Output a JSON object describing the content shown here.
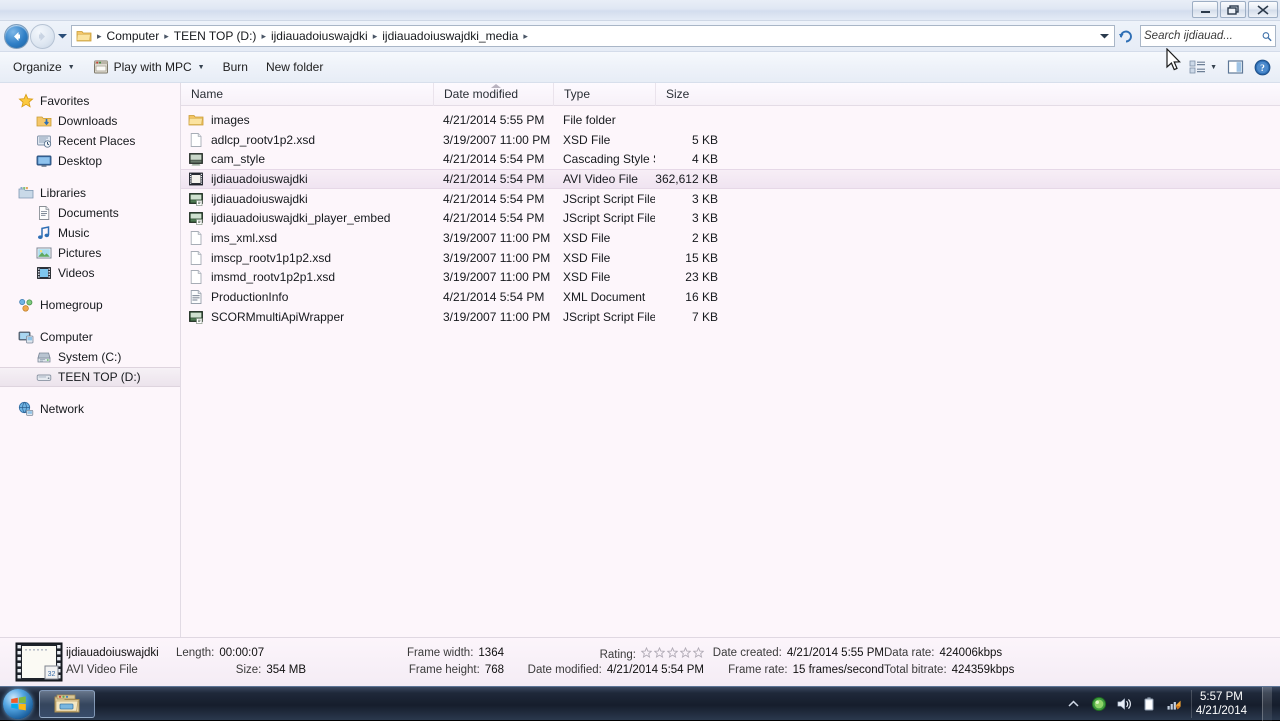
{
  "window": {
    "controls": [
      {
        "name": "minimize",
        "glyph": "minimize-icon"
      },
      {
        "name": "maximize",
        "glyph": "maximize-icon"
      },
      {
        "name": "close",
        "glyph": "close-icon"
      }
    ]
  },
  "address": {
    "back_label": "Back",
    "forward_label": "Forward",
    "recent_pages_label": "Recent pages",
    "breadcrumbs": [
      "Computer",
      "TEEN TOP (D:)",
      "ijdiauadoiuswajdki",
      "ijdiauadoiuswajdki_media"
    ],
    "dropdown_label": "Previous locations",
    "refresh_label": "Refresh",
    "separator": "▸"
  },
  "search": {
    "placeholder": "Search ijdiauad...",
    "value": "",
    "icon": "search-icon"
  },
  "toolbar": {
    "organize_label": "Organize",
    "play_label": "Play with MPC",
    "burn_label": "Burn",
    "new_folder_label": "New folder",
    "view_icon": "change-view-icon",
    "preview_icon": "preview-pane-icon",
    "help_icon": "help-icon"
  },
  "sidebar": {
    "groups": [
      {
        "header": {
          "label": "Favorites",
          "icon": "star-icon"
        },
        "items": [
          {
            "label": "Downloads",
            "icon": "downloads-icon"
          },
          {
            "label": "Recent Places",
            "icon": "recent-places-icon"
          },
          {
            "label": "Desktop",
            "icon": "desktop-icon"
          }
        ]
      },
      {
        "header": {
          "label": "Libraries",
          "icon": "libraries-icon"
        },
        "items": [
          {
            "label": "Documents",
            "icon": "documents-icon"
          },
          {
            "label": "Music",
            "icon": "music-icon"
          },
          {
            "label": "Pictures",
            "icon": "pictures-icon"
          },
          {
            "label": "Videos",
            "icon": "videos-icon"
          }
        ]
      },
      {
        "header": {
          "label": "Homegroup",
          "icon": "homegroup-icon"
        },
        "items": []
      },
      {
        "header": {
          "label": "Computer",
          "icon": "computer-icon"
        },
        "items": [
          {
            "label": "System (C:)",
            "icon": "hard-drive-icon",
            "selected": false
          },
          {
            "label": "TEEN TOP (D:)",
            "icon": "removable-drive-icon",
            "selected": true
          }
        ]
      },
      {
        "header": {
          "label": "Network",
          "icon": "network-icon"
        },
        "items": []
      }
    ]
  },
  "filelist": {
    "columns": [
      {
        "label": "Name",
        "key": "name"
      },
      {
        "label": "Date modified",
        "key": "date"
      },
      {
        "label": "Type",
        "key": "type"
      },
      {
        "label": "Size",
        "key": "size"
      }
    ],
    "sort": {
      "column": "Name",
      "direction": "ascending"
    },
    "rows": [
      {
        "name": "images",
        "date": "4/21/2014 5:55 PM",
        "type": "File folder",
        "size": "",
        "icon": "folder-icon",
        "selected": false
      },
      {
        "name": "adlcp_rootv1p2.xsd",
        "date": "3/19/2007 11:00 PM",
        "type": "XSD File",
        "size": "5 KB",
        "icon": "generic-file-icon",
        "selected": false
      },
      {
        "name": "cam_style",
        "date": "4/21/2014 5:54 PM",
        "type": "Cascading Style S...",
        "size": "4 KB",
        "icon": "css-file-icon",
        "selected": false
      },
      {
        "name": "ijdiauadoiuswajdki",
        "date": "4/21/2014 5:54 PM",
        "type": "AVI Video File",
        "size": "362,612 KB",
        "icon": "avi-file-icon",
        "selected": true
      },
      {
        "name": "ijdiauadoiuswajdki",
        "date": "4/21/2014 5:54 PM",
        "type": "JScript Script File",
        "size": "3 KB",
        "icon": "jscript-file-icon",
        "selected": false
      },
      {
        "name": "ijdiauadoiuswajdki_player_embed",
        "date": "4/21/2014 5:54 PM",
        "type": "JScript Script File",
        "size": "3 KB",
        "icon": "jscript-file-icon",
        "selected": false
      },
      {
        "name": "ims_xml.xsd",
        "date": "3/19/2007 11:00 PM",
        "type": "XSD File",
        "size": "2 KB",
        "icon": "generic-file-icon",
        "selected": false
      },
      {
        "name": "imscp_rootv1p1p2.xsd",
        "date": "3/19/2007 11:00 PM",
        "type": "XSD File",
        "size": "15 KB",
        "icon": "generic-file-icon",
        "selected": false
      },
      {
        "name": "imsmd_rootv1p2p1.xsd",
        "date": "3/19/2007 11:00 PM",
        "type": "XSD File",
        "size": "23 KB",
        "icon": "generic-file-icon",
        "selected": false
      },
      {
        "name": "ProductionInfo",
        "date": "4/21/2014 5:54 PM",
        "type": "XML Document",
        "size": "16 KB",
        "icon": "xml-file-icon",
        "selected": false
      },
      {
        "name": "SCORMmultiApiWrapper",
        "date": "3/19/2007 11:00 PM",
        "type": "JScript Script File",
        "size": "7 KB",
        "icon": "jscript-file-icon",
        "selected": false
      }
    ]
  },
  "details": {
    "thumbnail_icon": "avi-thumbnail-icon",
    "file_name": "ijdiauadoiuswajdki",
    "file_type": "AVI Video File",
    "length_label": "Length:",
    "length_value": "00:00:07",
    "size_label": "Size:",
    "size_value": "354 MB",
    "frame_width_label": "Frame width:",
    "frame_width_value": "1364",
    "frame_height_label": "Frame height:",
    "frame_height_value": "768",
    "rating_label": "Rating:",
    "rating_stars": 5,
    "rating_filled": 0,
    "date_modified_label": "Date modified:",
    "date_modified_value": "4/21/2014 5:54 PM",
    "date_created_label": "Date created:",
    "date_created_value": "4/21/2014 5:55 PM",
    "frame_rate_label": "Frame rate:",
    "frame_rate_value": "15 frames/second",
    "data_rate_label": "Data rate:",
    "data_rate_value": "424006kbps",
    "total_bitrate_label": "Total bitrate:",
    "total_bitrate_value": "424359kbps"
  },
  "taskbar": {
    "start_label": "Start",
    "start_icon": "windows-logo-icon",
    "items": [
      {
        "label": "Windows Explorer",
        "icon": "explorer-taskbar-icon"
      }
    ],
    "tray": [
      {
        "name": "show-hidden-icons",
        "icon": "chevron-up-icon"
      },
      {
        "name": "antivirus",
        "icon": "shield-green-icon"
      },
      {
        "name": "volume",
        "icon": "speaker-icon"
      },
      {
        "name": "battery",
        "icon": "battery-icon"
      },
      {
        "name": "network",
        "icon": "network-signal-icon"
      }
    ],
    "clock_time": "5:57 PM",
    "clock_date": "4/21/2014"
  }
}
